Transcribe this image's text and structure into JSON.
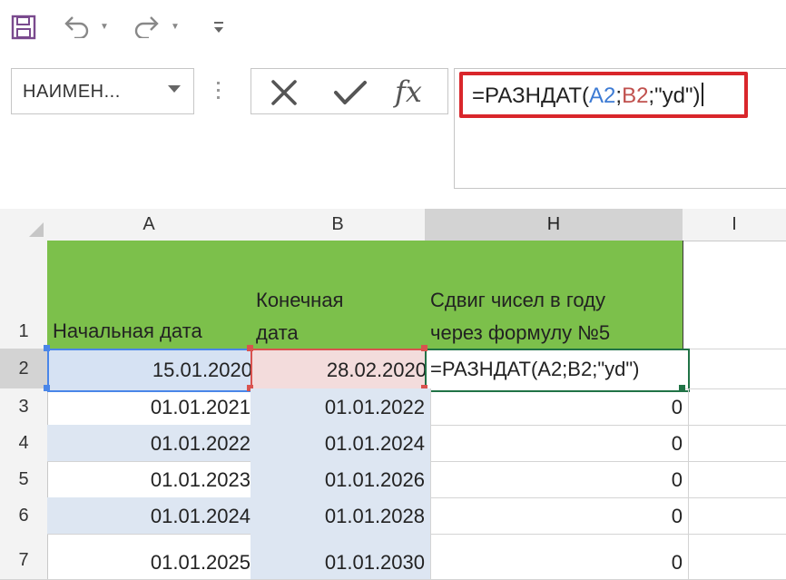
{
  "toolbar": {
    "name_box_value": "НАИМЕН...",
    "formula_text": "=РАЗНДАТ(A2;B2;\"yd\")",
    "formula_parts": [
      "=РАЗНДАТ(",
      "A2",
      ";",
      "B2",
      ";\"yd\")"
    ],
    "fx_label": "fx",
    "icons": [
      "save-icon",
      "undo-icon",
      "redo-icon",
      "customize-qat-icon",
      "cancel-icon",
      "enter-icon",
      "insert-function-icon"
    ]
  },
  "colors": {
    "header_fill": "#7cc04b",
    "highlight_border": "#d9262b",
    "ref_a": "#3d7bd4",
    "ref_b": "#c0504d",
    "selection": "#217346"
  },
  "grid": {
    "columns": [
      "A",
      "B",
      "H",
      "I"
    ],
    "row_numbers": [
      "1",
      "2",
      "3",
      "4",
      "5",
      "6",
      "7"
    ],
    "header_row": {
      "a": "Начальная дата",
      "b_line1": "Конечная",
      "b_line2": "дата",
      "h_line1": "Сдвиг чисел в году",
      "h_line2": "через формулу №5"
    },
    "rows": [
      {
        "a": "15.01.2020",
        "b": "28.02.2020",
        "h": "=РАЗНДАТ(A2;B2;\"yd\")"
      },
      {
        "a": "01.01.2021",
        "b": "01.01.2022",
        "h": "0"
      },
      {
        "a": "01.01.2022",
        "b": "01.01.2024",
        "h": "0"
      },
      {
        "a": "01.01.2023",
        "b": "01.01.2026",
        "h": "0"
      },
      {
        "a": "01.01.2024",
        "b": "01.01.2028",
        "h": "0"
      },
      {
        "a": "01.01.2025",
        "b": "01.01.2030",
        "h": "0"
      }
    ]
  }
}
